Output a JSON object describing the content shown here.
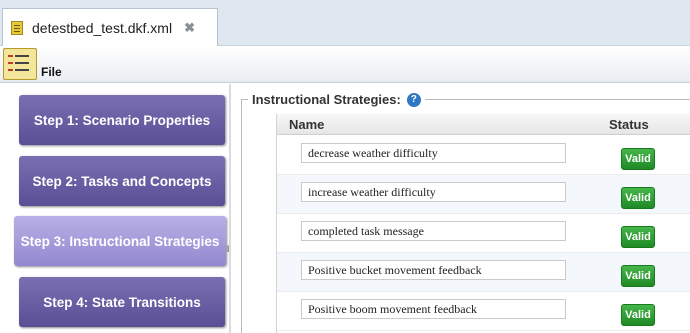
{
  "tab": {
    "title": "detestbed_test.dkf.xml",
    "close_glyph": "✖"
  },
  "menu": {
    "file_label": "File"
  },
  "steps": [
    {
      "label": "Step 1: Scenario Properties",
      "active": false
    },
    {
      "label": "Step 2: Tasks and Concepts",
      "active": false
    },
    {
      "label": "Step 3: Instructional Strategies",
      "active": true
    },
    {
      "label": "Step 4: State Transitions",
      "active": false
    }
  ],
  "panel": {
    "legend": "Instructional Strategies:",
    "help_glyph": "?",
    "columns": {
      "name": "Name",
      "status": "Status"
    },
    "rows": [
      {
        "name": "decrease weather difficulty",
        "status": "Valid"
      },
      {
        "name": "increase weather difficulty",
        "status": "Valid"
      },
      {
        "name": "completed task message",
        "status": "Valid"
      },
      {
        "name": "Positive bucket movement feedback",
        "status": "Valid"
      },
      {
        "name": "Positive boom movement feedback",
        "status": "Valid"
      }
    ]
  },
  "colors": {
    "step": "#5a4f95",
    "step_active": "#9288cf",
    "valid": "#1f8a25",
    "help": "#2f78c4"
  }
}
